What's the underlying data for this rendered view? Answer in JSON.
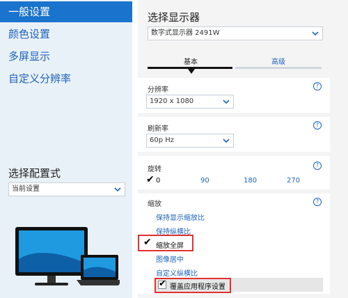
{
  "sidebar": {
    "items": [
      {
        "label": "一般设置",
        "active": true
      },
      {
        "label": "颜色设置",
        "active": false
      },
      {
        "label": "多屏显示",
        "active": false
      },
      {
        "label": "自定义分辨率",
        "active": false
      }
    ],
    "profile_title": "选择配置式",
    "profile_select": "当前设置"
  },
  "panel": {
    "title": "选择显示器",
    "display_select": "数字式显示器 2491W",
    "tabs": [
      "基本",
      "高级"
    ],
    "resolution": {
      "label": "分辨率",
      "value": "1920 x 1080"
    },
    "refresh": {
      "label": "刷新率",
      "value": "60p Hz"
    },
    "rotation": {
      "label": "旋转",
      "options": [
        "0",
        "90",
        "180",
        "270"
      ],
      "selected": "0"
    },
    "scaling": {
      "label": "缩放",
      "options": [
        "保持显示缩放比",
        "保持纵横比",
        "缩放全屏",
        "图像居中",
        "自定义纵横比"
      ],
      "selected": "缩放全屏",
      "override_label": "覆盖应用程序设置",
      "override_checked": true
    },
    "help_glyph": "?"
  },
  "colors": {
    "accent": "#1a73cc",
    "link": "#1f63b8",
    "highlight": "#e03030"
  }
}
